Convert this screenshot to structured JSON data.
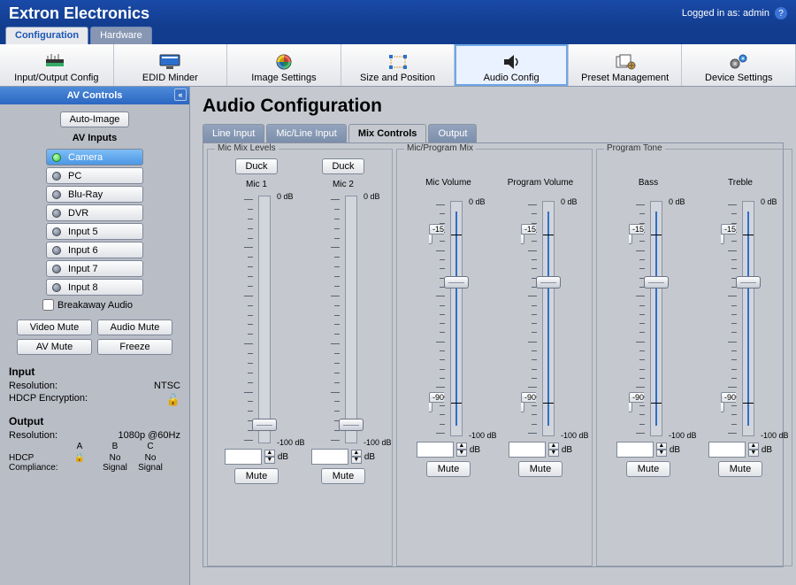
{
  "header": {
    "brand": "Extron Electronics",
    "login": "Logged in as: admin"
  },
  "top_tabs": {
    "config": "Configuration",
    "hardware": "Hardware"
  },
  "toolbar": [
    {
      "id": "io",
      "label": "Input/Output Config"
    },
    {
      "id": "edid",
      "label": "EDID Minder"
    },
    {
      "id": "image",
      "label": "Image Settings"
    },
    {
      "id": "size",
      "label": "Size and Position"
    },
    {
      "id": "audio",
      "label": "Audio Config",
      "active": true
    },
    {
      "id": "preset",
      "label": "Preset Management"
    },
    {
      "id": "device",
      "label": "Device Settings"
    }
  ],
  "sidebar": {
    "title": "AV Controls",
    "auto_image": "Auto-Image",
    "inputs_title": "AV Inputs",
    "inputs": [
      "Camera",
      "PC",
      "Blu-Ray",
      "DVR",
      "Input 5",
      "Input 6",
      "Input 7",
      "Input 8"
    ],
    "breakaway": "Breakaway Audio",
    "mutes": {
      "video": "Video Mute",
      "audio": "Audio Mute",
      "av": "AV Mute",
      "freeze": "Freeze"
    },
    "input_block": {
      "title": "Input",
      "res_lbl": "Resolution:",
      "res_val": "NTSC",
      "hdcp_lbl": "HDCP Encryption:"
    },
    "output_block": {
      "title": "Output",
      "res_lbl": "Resolution:",
      "res_val": "1080p @60Hz",
      "comp_lbl": "HDCP Compliance:",
      "cols": {
        "a": "A",
        "b": "B",
        "c": "C"
      },
      "vals": {
        "a": "🔒",
        "b": "No Signal",
        "c": "No Signal"
      }
    }
  },
  "main": {
    "title": "Audio Configuration",
    "subtabs": {
      "line": "Line Input",
      "micline": "Mic/Line Input",
      "mix": "Mix Controls",
      "output": "Output"
    },
    "mic_levels": {
      "legend": "Mic Mix Levels",
      "duck": "Duck",
      "mic1": "Mic 1",
      "mic2": "Mic 2",
      "top": "0 dB",
      "bottom": "-100 dB",
      "unit": "dB",
      "mute": "Mute"
    },
    "mix": {
      "legend": "Mic/Program Mix",
      "micvol": "Mic Volume",
      "progvol": "Program Volume",
      "top": "0 dB",
      "bottom": "-100 dB",
      "tag_top": "-15",
      "tag_bot": "-90",
      "unit": "dB",
      "mute": "Mute"
    },
    "tone": {
      "legend": "Program Tone",
      "bass": "Bass",
      "treble": "Treble",
      "top": "0 dB",
      "bottom": "-100 dB",
      "tag_top": "-15",
      "tag_bot": "-90",
      "unit": "dB",
      "mute": "Mute"
    }
  }
}
